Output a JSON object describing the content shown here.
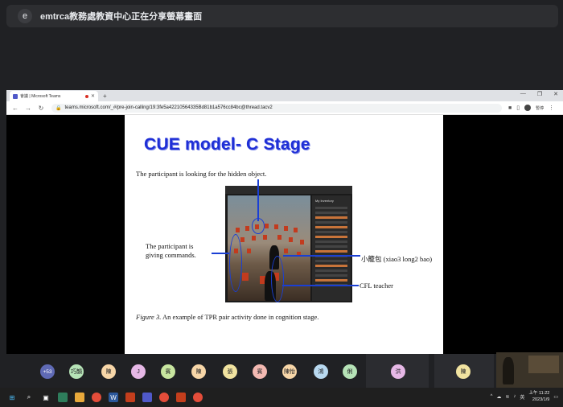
{
  "share_banner": {
    "avatar_letter": "e",
    "text": "emtrca教務處教資中心正在分享螢幕畫面"
  },
  "browser": {
    "tab_title": "會議 | Microsoft Teams",
    "new_tab": "+",
    "url": "teams.microsoft.com/_#/pre-join-calling/19:3fe5a42210564335Bd81b1a576cc84bc@thread.tacv2",
    "pause_label": "暫停",
    "window_controls": [
      "—",
      "❐",
      "✕"
    ]
  },
  "slide": {
    "title": "CUE model- C Stage",
    "subtitle": "The participant is looking for the hidden object.",
    "label_commands_line1": "The participant is",
    "label_commands_line2": "giving commands.",
    "label_xiaolongbao": "小籠包 (xiao3 long2 bao)",
    "label_teacher": "CFL teacher",
    "caption_figure": "Figure 3.",
    "caption_text": " An example of TPR pair activity done in cognition stage.",
    "inventory_title": "My Inventory"
  },
  "participants": [
    {
      "label": "+53",
      "color": "#5f6ab5"
    },
    {
      "label": "巧韻",
      "color": "#b6e3b7"
    },
    {
      "label": "陳",
      "color": "#f7d6a8"
    },
    {
      "label": "J",
      "color": "#e6b8e6"
    },
    {
      "label": "賓",
      "color": "#c8e6a0"
    },
    {
      "label": "陳",
      "color": "#f7d6a8"
    },
    {
      "label": "張",
      "color": "#f1e3a0"
    },
    {
      "label": "賓",
      "color": "#f3b9b2"
    },
    {
      "label": "陳怡",
      "color": "#f7d6a8"
    },
    {
      "label": "鴻",
      "color": "#b8d9f0"
    },
    {
      "label": "俐",
      "color": "#b6e3b7"
    },
    {
      "label": "洪",
      "color": "#e6b8e6"
    },
    {
      "label": "陳",
      "color": "#f1e3a0"
    }
  ],
  "taskbar": {
    "clock_line1": "上午 11:22",
    "clock_line2": "2023/1/9",
    "ime": "英",
    "tray_up": "^"
  }
}
